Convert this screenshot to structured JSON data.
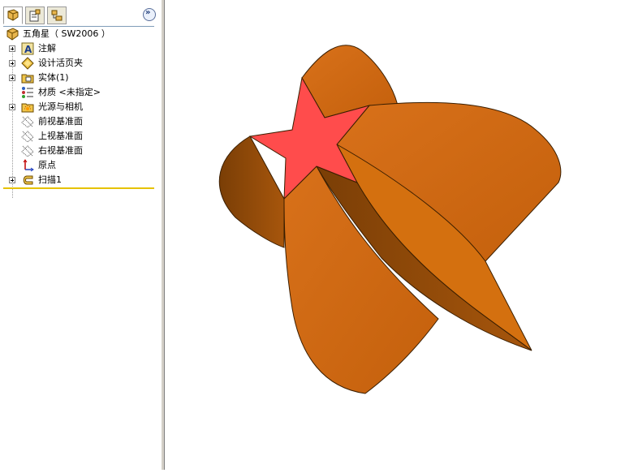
{
  "tabs": [
    {
      "name": "featuremanager-tab",
      "icon": "feature-tree-icon"
    },
    {
      "name": "propertymanager-tab",
      "icon": "property-manager-icon"
    },
    {
      "name": "configurationmanager-tab",
      "icon": "configuration-icon"
    }
  ],
  "collapse_label": "»",
  "tree": {
    "root": "五角星（ SW2006 ）",
    "items": [
      {
        "label": "注解",
        "icon": "annotation-icon",
        "expandable": true
      },
      {
        "label": "设计活页夹",
        "icon": "design-binder-icon",
        "expandable": true
      },
      {
        "label": "实体(1)",
        "icon": "solid-bodies-icon",
        "expandable": true
      },
      {
        "label": "材质 <未指定>",
        "icon": "material-icon",
        "expandable": false
      },
      {
        "label": "光源与相机",
        "icon": "lights-cameras-icon",
        "expandable": true
      },
      {
        "label": "前视基准面",
        "icon": "plane-icon",
        "expandable": false
      },
      {
        "label": "上视基准面",
        "icon": "plane-icon",
        "expandable": false
      },
      {
        "label": "右视基准面",
        "icon": "plane-icon",
        "expandable": false
      },
      {
        "label": "原点",
        "icon": "origin-icon",
        "expandable": false
      },
      {
        "label": "扫描1",
        "icon": "sweep-icon",
        "expandable": true
      }
    ]
  },
  "colors": {
    "model_orange": "#d66c12",
    "model_dark": "#8c4708",
    "star_face": "#ff4c4c",
    "panel_separator": "#e6c200"
  }
}
